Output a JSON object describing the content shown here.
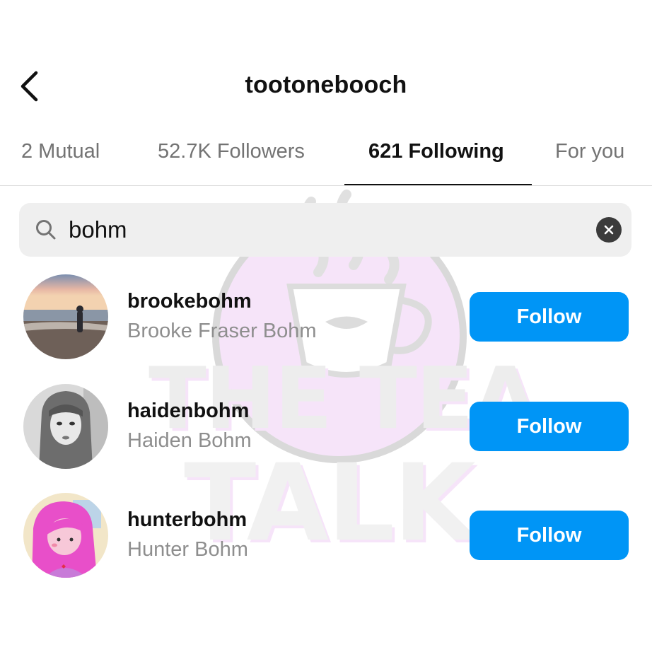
{
  "header": {
    "title": "tootonebooch",
    "back_icon": "chevron-left-icon"
  },
  "tabs": [
    {
      "label": "2 Mutual",
      "active": false
    },
    {
      "label": "52.7K Followers",
      "active": false
    },
    {
      "label": "621 Following",
      "active": true
    },
    {
      "label": "For you",
      "active": false
    }
  ],
  "search": {
    "value": "bohm",
    "icon": "search-icon",
    "clear_icon": "clear-icon"
  },
  "results": [
    {
      "username": "brookebohm",
      "full_name": "Brooke Fraser Bohm",
      "button_label": "Follow"
    },
    {
      "username": "haidenbohm",
      "full_name": "Haiden Bohm",
      "button_label": "Follow"
    },
    {
      "username": "hunterbohm",
      "full_name": "Hunter Bohm",
      "button_label": "Follow"
    }
  ],
  "watermark": {
    "line1": "THE TEA",
    "line2": "TALK"
  },
  "colors": {
    "follow_button": "#0095f6",
    "watermark_pink": "#e0a8e8",
    "secondary_text": "#8e8e8e"
  }
}
